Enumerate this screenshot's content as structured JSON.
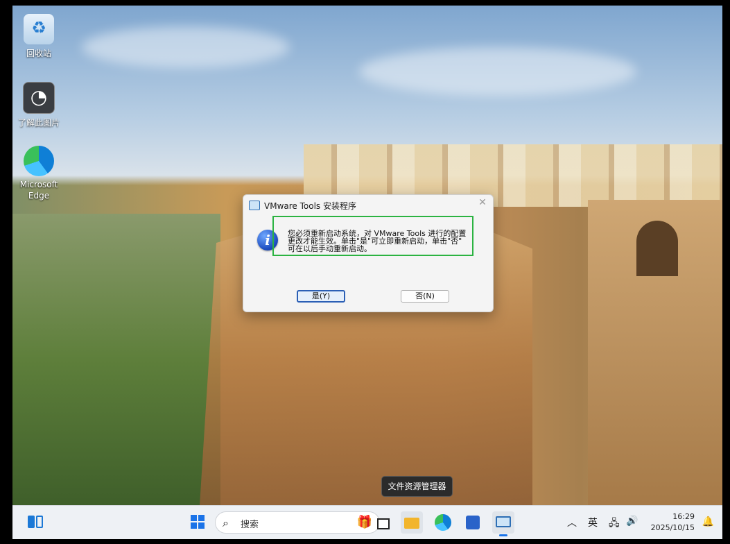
{
  "desktop": {
    "icons": [
      {
        "label": "回收站"
      },
      {
        "label": "了解此图片"
      },
      {
        "label": "Microsoft Edge"
      }
    ]
  },
  "dialog": {
    "title": "VMware Tools 安装程序",
    "message_lines": [
      "您必须重新启动系统，对 VMware Tools 进行的配置",
      "更改才能生效。单击\"是\"可立即重新启动，单击\"否\"",
      "可在以后手动重新启动。"
    ],
    "yes_label": "是(Y)",
    "no_label": "否(N)"
  },
  "tooltip": {
    "text": "文件资源管理器"
  },
  "taskbar": {
    "search_placeholder": "搜索",
    "ime": "英",
    "time": "16:29",
    "date": "2025/10/15"
  }
}
